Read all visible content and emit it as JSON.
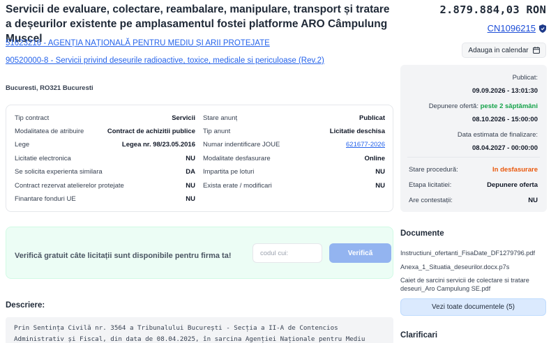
{
  "header": {
    "title": "Servicii de evaluare, colectare, reambalare, manipulare, transport și tratare a deșeurilor existente pe amplasamentul fostei platforme ARO Câmpulung Muscel",
    "price": "2.879.884,03 RON",
    "code": "CN1096215"
  },
  "links": {
    "authority": "51623216 - AGENȚIA NAȚIONALĂ PENTRU MEDIU ȘI ARII PROTEJATE",
    "cpv": "90520000-8 - Servicii privind deseurile radioactive, toxice, medicale si periculoase (Rev.2)"
  },
  "address": "Bucuresti, RO321 Bucuresti",
  "calendar": {
    "label": "Adauga in calendar"
  },
  "details_left": [
    {
      "label": "Tip contract",
      "value": "Servicii"
    },
    {
      "label": "Modalitatea de atribuire",
      "value": "Contract de achizitii publice"
    },
    {
      "label": "Lege",
      "value": "Legea nr. 98/23.05.2016"
    },
    {
      "label": "Licitatie electronica",
      "value": "NU"
    },
    {
      "label": "Se solicita experienta similara",
      "value": "DA"
    },
    {
      "label": "Contract rezervat atelierelor protejate",
      "value": "NU"
    },
    {
      "label": "Finantare fonduri UE",
      "value": "NU"
    }
  ],
  "details_right": [
    {
      "label": "Stare anunț",
      "value": "Publicat"
    },
    {
      "label": "Tip anunt",
      "value": "Licitatie deschisa"
    },
    {
      "label": "Numar indentificare JOUE",
      "value": "621677-2026"
    },
    {
      "label": "Modalitate desfasurare",
      "value": "Online"
    },
    {
      "label": "Impartita pe loturi",
      "value": "NU"
    },
    {
      "label": "Exista erate / modificari",
      "value": "NU"
    }
  ],
  "side": {
    "published_label": "Publicat:",
    "published_value": "09.09.2026 - 13:01:30",
    "deadline_label": "Depunere ofertă:",
    "deadline_note": "peste 2 săptămâni",
    "deadline_value": "08.10.2026 - 15:00:00",
    "estimate_label": "Data estimata de finalizare:",
    "estimate_value": "08.04.2027 - 00:00:00",
    "status_label": "Stare procedură:",
    "status_value": "In desfasurare",
    "stage_label": "Etapa licitatiei:",
    "stage_value": "Depunere oferta",
    "appeals_label": "Are contestații:",
    "appeals_value": "NU",
    "colors": {
      "green": "#16a34a",
      "orange": "#ea580c"
    }
  },
  "promo": {
    "text": "Verifică gratuit câte licitații sunt disponibile pentru firma ta!",
    "placeholder": "codul cui:",
    "button": "Verifică"
  },
  "description": {
    "heading": "Descriere:",
    "text": "Prin Sentința Civilă nr. 3564 a Tribunalului București - Secția a II-A de Contencios Administrativ și Fiscal, din data de 08.04.2025, în sarcina Agenției Naționale pentru Mediu"
  },
  "documents": {
    "heading": "Documente",
    "items": [
      "Instructiuni_ofertanti_FisaDate_DF1279796.pdf",
      "Anexa_1_Situatia_deseurilor.docx.p7s",
      "Caiet de sarcini servicii de colectare si tratare deseuri_Aro Campulung SE.pdf"
    ],
    "view_all": "Vezi toate documentele (5)"
  },
  "clarifications": {
    "heading": "Clarificari"
  }
}
